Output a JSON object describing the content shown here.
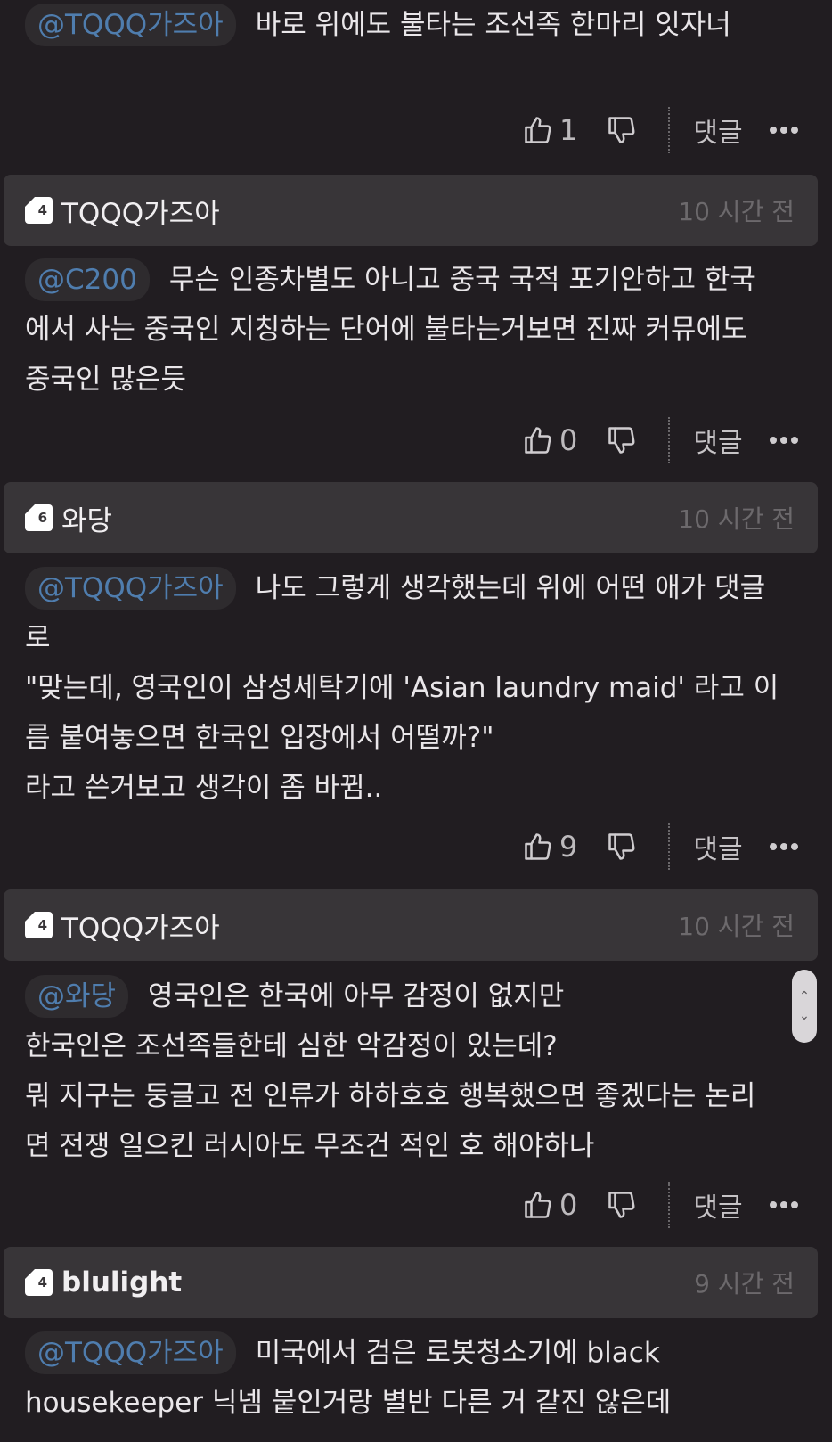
{
  "comments": [
    {
      "body": {
        "mention": "@TQQQ가즈아",
        "lines": [
          "바로 위에도 불타는 조선족 한마리 잇자너"
        ]
      },
      "actions": {
        "likes": "1",
        "reply_label": "댓글"
      }
    },
    {
      "header": {
        "level": "4",
        "username": "TQQQ가즈아",
        "time": "10 시간 전"
      },
      "body": {
        "mention": "@C200",
        "lines": [
          "무슨 인종차별도 아니고 중국 국적 포기안하고 한국",
          "에서 사는 중국인 지칭하는 단어에 불타는거보면 진짜 커뮤에도",
          "중국인 많은듯"
        ]
      },
      "actions": {
        "likes": "0",
        "reply_label": "댓글"
      }
    },
    {
      "header": {
        "level": "6",
        "username": "와당",
        "time": "10 시간 전"
      },
      "body": {
        "mention": "@TQQQ가즈아",
        "lines": [
          "나도 그렇게 생각했는데 위에 어떤 애가 댓글",
          "로",
          "\"맞는데, 영국인이 삼성세탁기에 'Asian laundry maid' 라고 이",
          "름 붙여놓으면 한국인 입장에서 어떨까?\"",
          "라고 쓴거보고 생각이 좀 바뀜.."
        ]
      },
      "actions": {
        "likes": "9",
        "reply_label": "댓글"
      }
    },
    {
      "header": {
        "level": "4",
        "username": "TQQQ가즈아",
        "time": "10 시간 전"
      },
      "body": {
        "mention": "@와당",
        "lines": [
          "영국인은 한국에 아무 감정이 없지만",
          "한국인은 조선족들한테 심한 악감정이 있는데?",
          "뭐 지구는 둥글고 전 인류가 하하호호 행복했으면 좋겠다는 논리",
          "면 전쟁 일으킨 러시아도 무조건 적인 호 해야하나"
        ]
      },
      "actions": {
        "likes": "0",
        "reply_label": "댓글"
      }
    },
    {
      "header": {
        "level": "4",
        "username": "blulight",
        "time": "9 시간 전"
      },
      "body": {
        "mention": "@TQQQ가즈아",
        "lines": [
          "미국에서 검은 로봇청소기에 black",
          "housekeeper 닉넴 붙인거랑 별반 다른 거 같진 않은데"
        ]
      }
    }
  ],
  "icons": {
    "like": "thumbs-up-icon",
    "dislike": "thumbs-down-icon",
    "more": "more-dots-icon",
    "level": "level-badge-icon",
    "scroll": "scroll-up-down-icon"
  }
}
